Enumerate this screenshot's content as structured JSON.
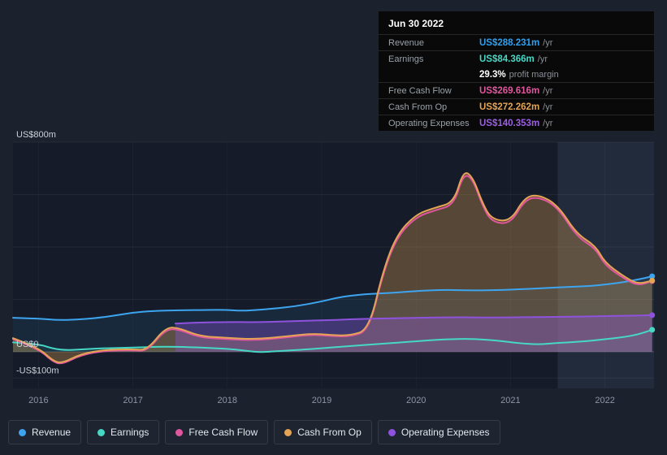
{
  "colors": {
    "page_bg": "#1b212d",
    "plot_bg": "#151b28",
    "highlight_band": "rgba(125,156,200,0.13)",
    "grid_line": "rgba(255,255,255,0.06)",
    "zero_line": "rgba(255,255,255,0.20)",
    "tick_line": "rgba(255,255,255,0.03)",
    "axis_text": "#ccd3db",
    "tick_text": "#8d96a3",
    "tooltip_bg": "#090909"
  },
  "tooltip": {
    "date": "Jun 30 2022",
    "rows": [
      {
        "label": "Revenue",
        "value": "US$288.231m",
        "suffix": "/yr",
        "color": "#2f9ff0",
        "group_with_prev": false
      },
      {
        "label": "Earnings",
        "value": "US$84.366m",
        "suffix": "/yr",
        "color": "#46d8c5",
        "group_with_prev": false
      },
      {
        "label": "",
        "value": "29.3%",
        "suffix": "profit margin",
        "color": "#ffffff",
        "group_with_prev": true
      },
      {
        "label": "Free Cash Flow",
        "value": "US$269.616m",
        "suffix": "/yr",
        "color": "#e0569e",
        "group_with_prev": false
      },
      {
        "label": "Cash From Op",
        "value": "US$272.262m",
        "suffix": "/yr",
        "color": "#e3a455",
        "group_with_prev": false
      },
      {
        "label": "Operating Expenses",
        "value": "US$140.353m",
        "suffix": "/yr",
        "color": "#9b5fe0",
        "group_with_prev": false
      }
    ]
  },
  "chart_data": {
    "type": "area",
    "title": "",
    "xlabel": "",
    "ylabel": "",
    "x_unit": "year",
    "xlim": [
      2015.73,
      2022.52
    ],
    "ylim": [
      -139,
      800
    ],
    "y_gridlines": [
      800,
      600,
      400,
      200,
      0,
      -100
    ],
    "y_axis_labels": [
      {
        "value": 800,
        "text": "US$800m"
      },
      {
        "value": 0,
        "text": "US$0"
      },
      {
        "value": -100,
        "text": "-US$100m"
      }
    ],
    "x_ticks": [
      2016,
      2017,
      2018,
      2019,
      2020,
      2021,
      2022
    ],
    "highlight_x_range": [
      2021.5,
      2022.52
    ],
    "legend_position": "bottom-left",
    "grid": true,
    "series": [
      {
        "name": "Revenue",
        "color": "#3da5f0",
        "fill_opacity": 0.1,
        "points": [
          [
            2015.73,
            130
          ],
          [
            2016.0,
            127
          ],
          [
            2016.2,
            121
          ],
          [
            2016.4,
            123
          ],
          [
            2016.6,
            128
          ],
          [
            2016.8,
            138
          ],
          [
            2017.0,
            150
          ],
          [
            2017.2,
            156
          ],
          [
            2017.5,
            159
          ],
          [
            2017.8,
            160
          ],
          [
            2018.0,
            160
          ],
          [
            2018.15,
            156
          ],
          [
            2018.4,
            162
          ],
          [
            2018.7,
            172
          ],
          [
            2019.0,
            192
          ],
          [
            2019.2,
            210
          ],
          [
            2019.45,
            220
          ],
          [
            2019.7,
            224
          ],
          [
            2020.0,
            232
          ],
          [
            2020.3,
            237
          ],
          [
            2020.6,
            234
          ],
          [
            2020.9,
            236
          ],
          [
            2021.2,
            240
          ],
          [
            2021.5,
            246
          ],
          [
            2021.8,
            250
          ],
          [
            2022.0,
            256
          ],
          [
            2022.2,
            266
          ],
          [
            2022.35,
            276
          ],
          [
            2022.5,
            288
          ]
        ]
      },
      {
        "name": "Earnings",
        "color": "#46d8c5",
        "fill_opacity": 0.08,
        "points": [
          [
            2015.73,
            36
          ],
          [
            2016.0,
            30
          ],
          [
            2016.15,
            12
          ],
          [
            2016.3,
            6
          ],
          [
            2016.5,
            10
          ],
          [
            2016.7,
            14
          ],
          [
            2017.0,
            16
          ],
          [
            2017.3,
            20
          ],
          [
            2017.6,
            18
          ],
          [
            2018.0,
            12
          ],
          [
            2018.2,
            4
          ],
          [
            2018.35,
            -2
          ],
          [
            2018.5,
            2
          ],
          [
            2018.8,
            8
          ],
          [
            2019.0,
            14
          ],
          [
            2019.3,
            22
          ],
          [
            2019.6,
            30
          ],
          [
            2020.0,
            40
          ],
          [
            2020.3,
            48
          ],
          [
            2020.6,
            50
          ],
          [
            2020.9,
            42
          ],
          [
            2021.1,
            32
          ],
          [
            2021.3,
            28
          ],
          [
            2021.5,
            34
          ],
          [
            2021.8,
            40
          ],
          [
            2022.0,
            48
          ],
          [
            2022.2,
            56
          ],
          [
            2022.35,
            66
          ],
          [
            2022.5,
            84
          ]
        ]
      },
      {
        "name": "Free Cash Flow",
        "color": "#e0569e",
        "fill_opacity": 0,
        "points": [
          [
            2015.73,
            48
          ],
          [
            2016.0,
            12
          ],
          [
            2016.15,
            -38
          ],
          [
            2016.25,
            -48
          ],
          [
            2016.45,
            -12
          ],
          [
            2016.7,
            4
          ],
          [
            2017.0,
            6
          ],
          [
            2017.15,
            2
          ],
          [
            2017.35,
            88
          ],
          [
            2017.5,
            84
          ],
          [
            2017.7,
            55
          ],
          [
            2018.0,
            48
          ],
          [
            2018.3,
            44
          ],
          [
            2018.6,
            54
          ],
          [
            2018.9,
            66
          ],
          [
            2019.1,
            60
          ],
          [
            2019.3,
            58
          ],
          [
            2019.5,
            80
          ],
          [
            2019.65,
            300
          ],
          [
            2019.8,
            440
          ],
          [
            2020.0,
            515
          ],
          [
            2020.2,
            540
          ],
          [
            2020.4,
            560
          ],
          [
            2020.5,
            680
          ],
          [
            2020.6,
            660
          ],
          [
            2020.7,
            560
          ],
          [
            2020.8,
            495
          ],
          [
            2021.0,
            488
          ],
          [
            2021.15,
            580
          ],
          [
            2021.3,
            592
          ],
          [
            2021.5,
            552
          ],
          [
            2021.7,
            440
          ],
          [
            2021.9,
            395
          ],
          [
            2022.0,
            330
          ],
          [
            2022.2,
            280
          ],
          [
            2022.35,
            252
          ],
          [
            2022.5,
            270
          ]
        ]
      },
      {
        "name": "Cash From Op",
        "color": "#e3a455",
        "fill_opacity": 0.32,
        "points": [
          [
            2015.73,
            52
          ],
          [
            2016.0,
            16
          ],
          [
            2016.15,
            -34
          ],
          [
            2016.25,
            -44
          ],
          [
            2016.45,
            -8
          ],
          [
            2016.7,
            8
          ],
          [
            2017.0,
            10
          ],
          [
            2017.15,
            6
          ],
          [
            2017.35,
            95
          ],
          [
            2017.5,
            90
          ],
          [
            2017.7,
            60
          ],
          [
            2018.0,
            53
          ],
          [
            2018.3,
            48
          ],
          [
            2018.6,
            58
          ],
          [
            2018.9,
            70
          ],
          [
            2019.1,
            64
          ],
          [
            2019.3,
            62
          ],
          [
            2019.5,
            85
          ],
          [
            2019.65,
            310
          ],
          [
            2019.8,
            450
          ],
          [
            2020.0,
            525
          ],
          [
            2020.2,
            550
          ],
          [
            2020.4,
            570
          ],
          [
            2020.5,
            692
          ],
          [
            2020.6,
            668
          ],
          [
            2020.7,
            570
          ],
          [
            2020.8,
            505
          ],
          [
            2021.0,
            498
          ],
          [
            2021.15,
            590
          ],
          [
            2021.3,
            600
          ],
          [
            2021.5,
            560
          ],
          [
            2021.7,
            450
          ],
          [
            2021.9,
            405
          ],
          [
            2022.0,
            340
          ],
          [
            2022.2,
            288
          ],
          [
            2022.35,
            258
          ],
          [
            2022.5,
            272
          ]
        ]
      },
      {
        "name": "Operating Expenses",
        "color": "#8f52dc",
        "fill_opacity": 0.35,
        "points": [
          [
            2017.45,
            108
          ],
          [
            2017.7,
            112
          ],
          [
            2018.0,
            114
          ],
          [
            2018.3,
            113
          ],
          [
            2018.6,
            116
          ],
          [
            2019.0,
            120
          ],
          [
            2019.3,
            124
          ],
          [
            2019.6,
            127
          ],
          [
            2020.0,
            130
          ],
          [
            2020.4,
            132
          ],
          [
            2020.8,
            131
          ],
          [
            2021.2,
            132
          ],
          [
            2021.6,
            134
          ],
          [
            2022.0,
            136
          ],
          [
            2022.3,
            138
          ],
          [
            2022.5,
            140
          ]
        ]
      }
    ]
  }
}
